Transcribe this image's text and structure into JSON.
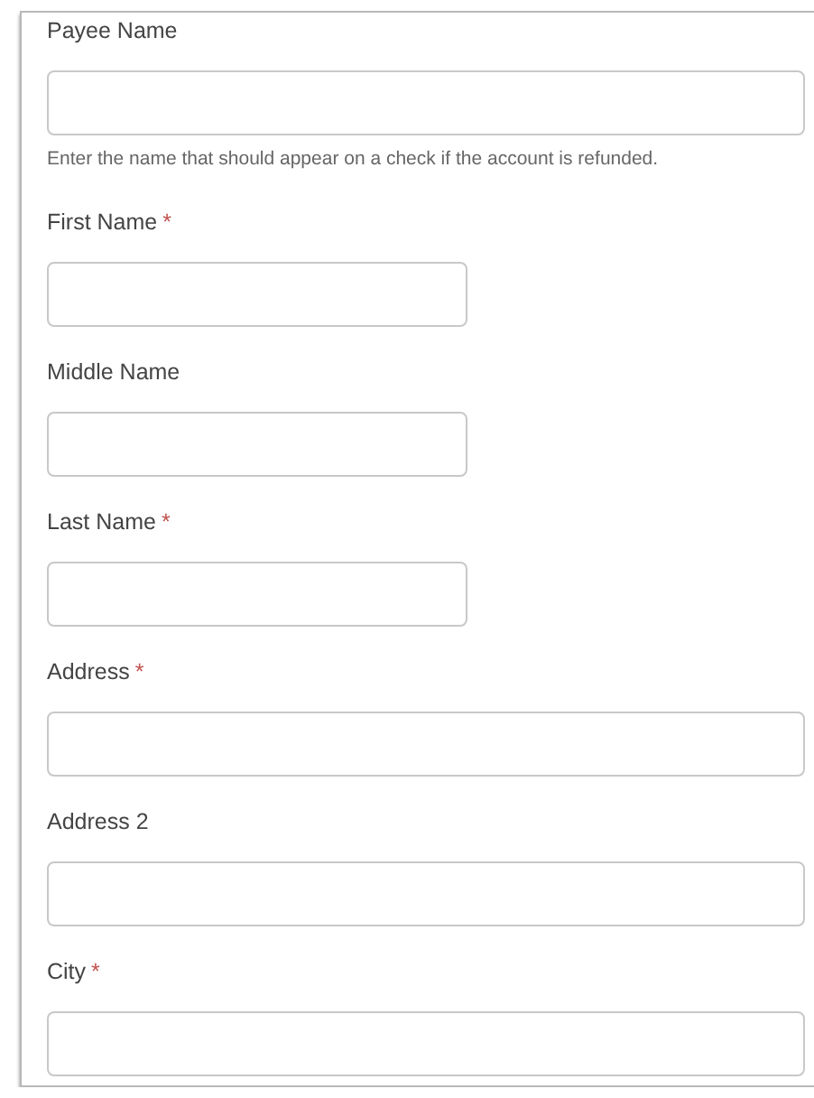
{
  "fields": [
    {
      "label": "Payee Name",
      "kind": "full",
      "help": "Enter the name that should appear on a check if the account is refunded."
    },
    {
      "label": "First Name",
      "kind": "short",
      "required_mark": "*"
    },
    {
      "label": "Middle Name",
      "kind": "short"
    },
    {
      "label": "Last Name",
      "kind": "short",
      "required_mark": "*"
    },
    {
      "label": "Address",
      "kind": "full",
      "required_mark": "*"
    },
    {
      "label": "Address 2",
      "kind": "full"
    },
    {
      "label": "City",
      "kind": "full",
      "required_mark": "*"
    }
  ]
}
